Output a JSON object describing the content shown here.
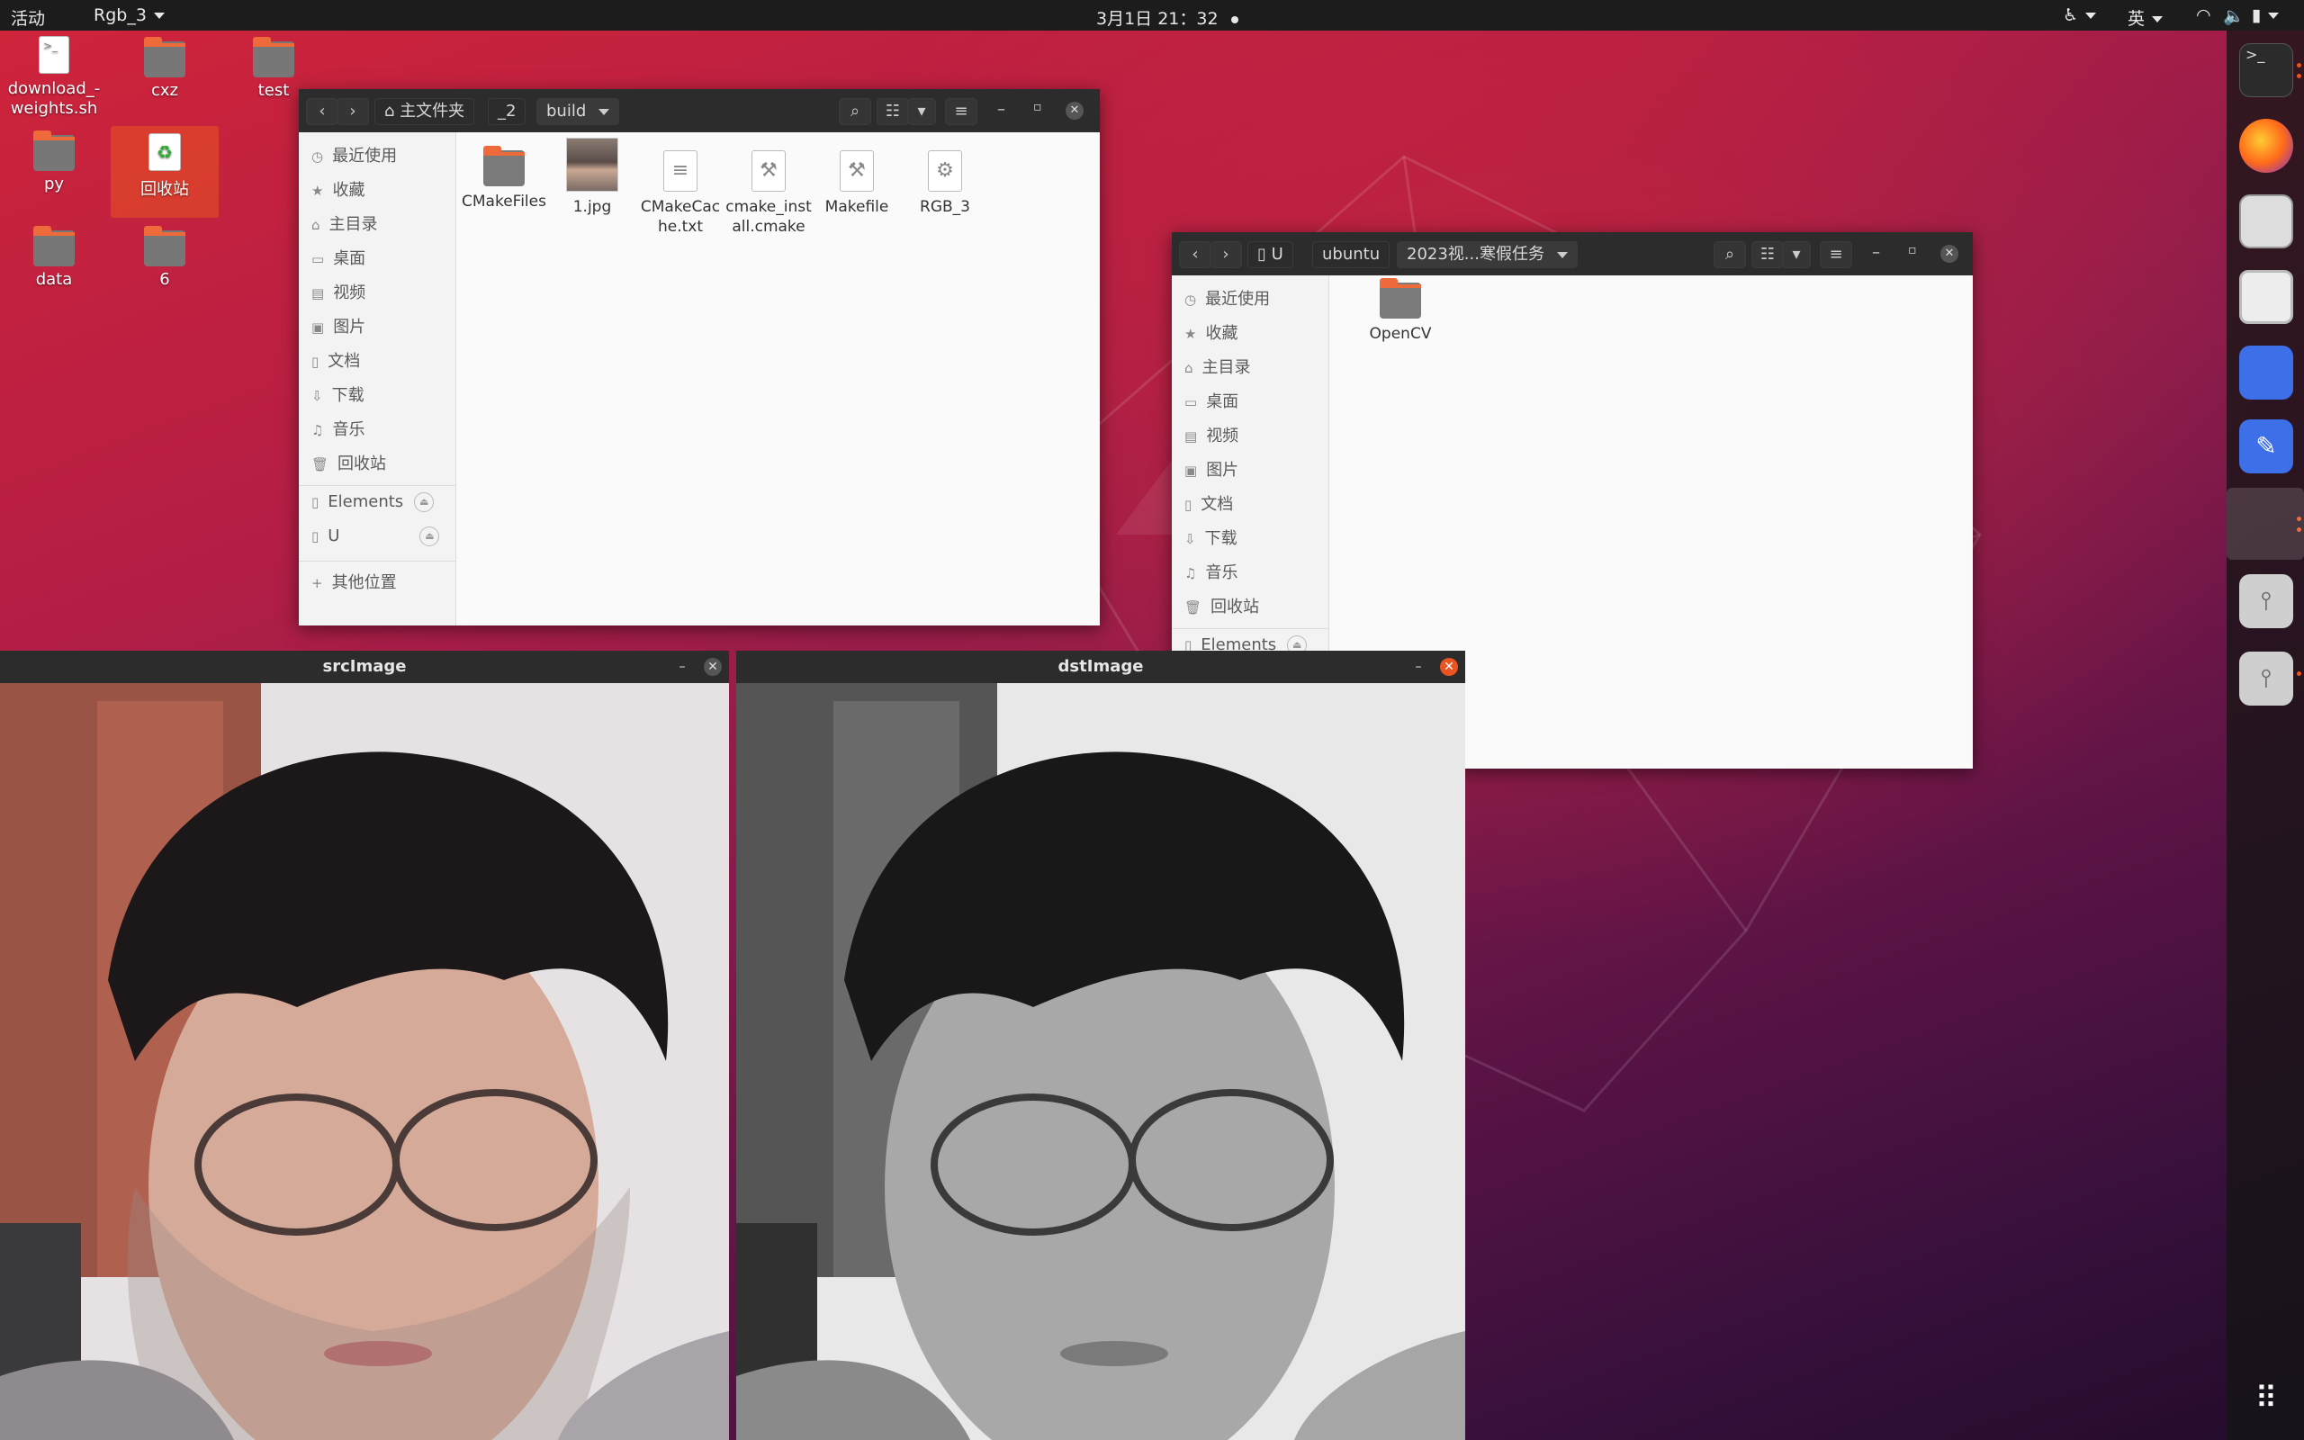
{
  "topbar": {
    "activities": "活动",
    "app_menu": "Rgb_3",
    "clock": "3月1日  21：32",
    "input_method": "英"
  },
  "desktop": {
    "icons": [
      {
        "label": "download_-weights.sh"
      },
      {
        "label": "cxz"
      },
      {
        "label": "test"
      },
      {
        "label": "py"
      },
      {
        "label": "回收站"
      },
      {
        "label": "data"
      },
      {
        "label": "6"
      }
    ]
  },
  "fm1": {
    "breadcrumbs": [
      "主文件夹",
      "_2",
      "build"
    ],
    "sidebar": [
      "最近使用",
      "收藏",
      "主目录",
      "桌面",
      "视频",
      "图片",
      "文档",
      "下载",
      "音乐",
      "回收站"
    ],
    "devices": [
      "Elements",
      "U"
    ],
    "other": "其他位置",
    "files": [
      {
        "name": "CMakeFiles"
      },
      {
        "name": "1.jpg"
      },
      {
        "name": "CMakeCache.txt"
      },
      {
        "name": "cmake_install.cmake"
      },
      {
        "name": "Makefile"
      },
      {
        "name": "RGB_3"
      }
    ]
  },
  "fm2": {
    "breadcrumbs": [
      "U",
      "ubuntu",
      "2023视...寒假任务"
    ],
    "sidebar": [
      "最近使用",
      "收藏",
      "主目录",
      "桌面",
      "视频",
      "图片",
      "文档",
      "下载",
      "音乐",
      "回收站"
    ],
    "devices": [
      "Elements"
    ],
    "files": [
      {
        "name": "OpenCV"
      }
    ]
  },
  "src": {
    "title": "srcImage"
  },
  "dst": {
    "title": "dstImage"
  }
}
